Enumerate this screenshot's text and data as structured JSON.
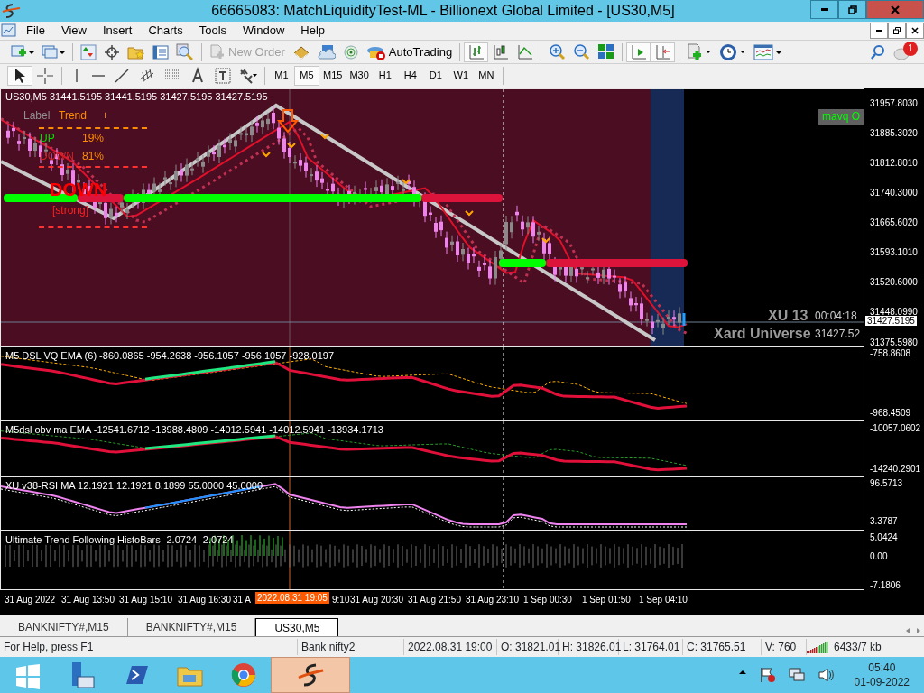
{
  "window": {
    "title": "66665083: MatchLiquidityTest-ML - Billionext Global Limited - [US30,M5]"
  },
  "menu": [
    "File",
    "View",
    "Insert",
    "Charts",
    "Tools",
    "Window",
    "Help"
  ],
  "toolbar": {
    "new_order": {
      "label": "New Order",
      "disabled": true
    },
    "autotrading": {
      "label": "AutoTrading"
    },
    "notifications": "1",
    "chart_buttons": [
      {
        "pressed": true
      },
      {
        "pressed": false
      },
      {
        "pressed": false
      },
      {
        "pressed": false
      },
      {
        "pressed": false
      },
      {
        "pressed": false
      },
      {
        "pressed": true
      },
      {
        "pressed": true
      }
    ],
    "line_tools": [
      {
        "pressed": true
      },
      {
        "pressed": false
      },
      {
        "pressed": false
      },
      {
        "pressed": false
      },
      {
        "pressed": false
      },
      {
        "pressed": false
      },
      {
        "pressed": false
      },
      {
        "pressed": false
      },
      {
        "pressed": false
      },
      {
        "pressed": false
      }
    ]
  },
  "periods": [
    {
      "label": "M1",
      "selected": false
    },
    {
      "label": "M5",
      "selected": true
    },
    {
      "label": "M15",
      "selected": false
    },
    {
      "label": "M30",
      "selected": false
    },
    {
      "label": "H1",
      "selected": false
    },
    {
      "label": "H4",
      "selected": false
    },
    {
      "label": "D1",
      "selected": false
    },
    {
      "label": "W1",
      "selected": false
    },
    {
      "label": "MN",
      "selected": false
    }
  ],
  "chart": {
    "header": "US30,M5  31441.5195 31441.5195 31427.5195 31427.5195",
    "trend_panel": {
      "label": "Label",
      "title": "Trend",
      "plus": "+",
      "up_label": "UP",
      "up_value": "19%",
      "down_label": "DOWN",
      "down_value": "81%",
      "signal": "DOWN",
      "strength": "[strong]"
    },
    "mavq": "mavq O",
    "xu": "XU 13",
    "countdown": "00:04:18",
    "xard": "Xard Universe",
    "xard_price": "31427.52",
    "price_axis": [
      "31957.8030",
      "31885.3020",
      "31812.8010",
      "31740.3000",
      "31665.6020",
      "31593.1010",
      "31520.6000",
      "31448.0990",
      "31375.5980"
    ],
    "current_price": "31427.5195",
    "time_axis": [
      "31 Aug 2022",
      "31 Aug 13:50",
      "31 Aug 15:10",
      "31 Aug 16:30",
      "31 A",
      "9:10",
      "31 Aug 20:30",
      "31 Aug 21:50",
      "31 Aug 23:10",
      "1 Sep 00:30",
      "1 Sep 01:50",
      "1 Sep 04:10"
    ],
    "crosshair_time": "2022.08.31 19:05"
  },
  "indicators": [
    {
      "title": "M5 DSL  VQ  EMA (6)   -860.0865 -954.2638 -956.1057 -956.1057 -928.0197",
      "axis": [
        "-758.8608",
        "-968.4509"
      ]
    },
    {
      "title": "M5dsl  obv ma  EMA  -12541.6712 -13988.4809 -14012.5941 -14012.5941 -13934.1713",
      "axis": [
        "-10057.0602",
        "-14240.2901"
      ]
    },
    {
      "title": "XU v38-RSI MA 12.1921 12.1921 8.1899 55.0000 45.0000",
      "axis": [
        "96.5713",
        "3.3787"
      ]
    },
    {
      "title": "Ultimate Trend Following HistoBars -2.0724 -2.0724",
      "axis": [
        "5.0424",
        "0.00",
        "-7.1806"
      ]
    }
  ],
  "tabs": [
    {
      "label": "BANKNIFTY#,M15",
      "selected": false
    },
    {
      "label": "BANKNIFTY#,M15",
      "selected": false
    },
    {
      "label": "US30,M5",
      "selected": true
    }
  ],
  "status_bar": {
    "help": "For Help, press F1",
    "profile": "Bank nifty2",
    "time": "2022.08.31 19:00",
    "open": "O: 31821.01",
    "high": "H: 31826.01",
    "low": "L: 31764.01",
    "close": "C: 31765.51",
    "volume": "V: 760",
    "connection": "6433/7 kb"
  },
  "taskbar": {
    "apps": [
      {
        "selected": false
      },
      {
        "selected": false
      },
      {
        "selected": false
      },
      {
        "selected": false
      },
      {
        "selected": true
      }
    ],
    "time": "05:40",
    "date": "01-09-2022"
  }
}
